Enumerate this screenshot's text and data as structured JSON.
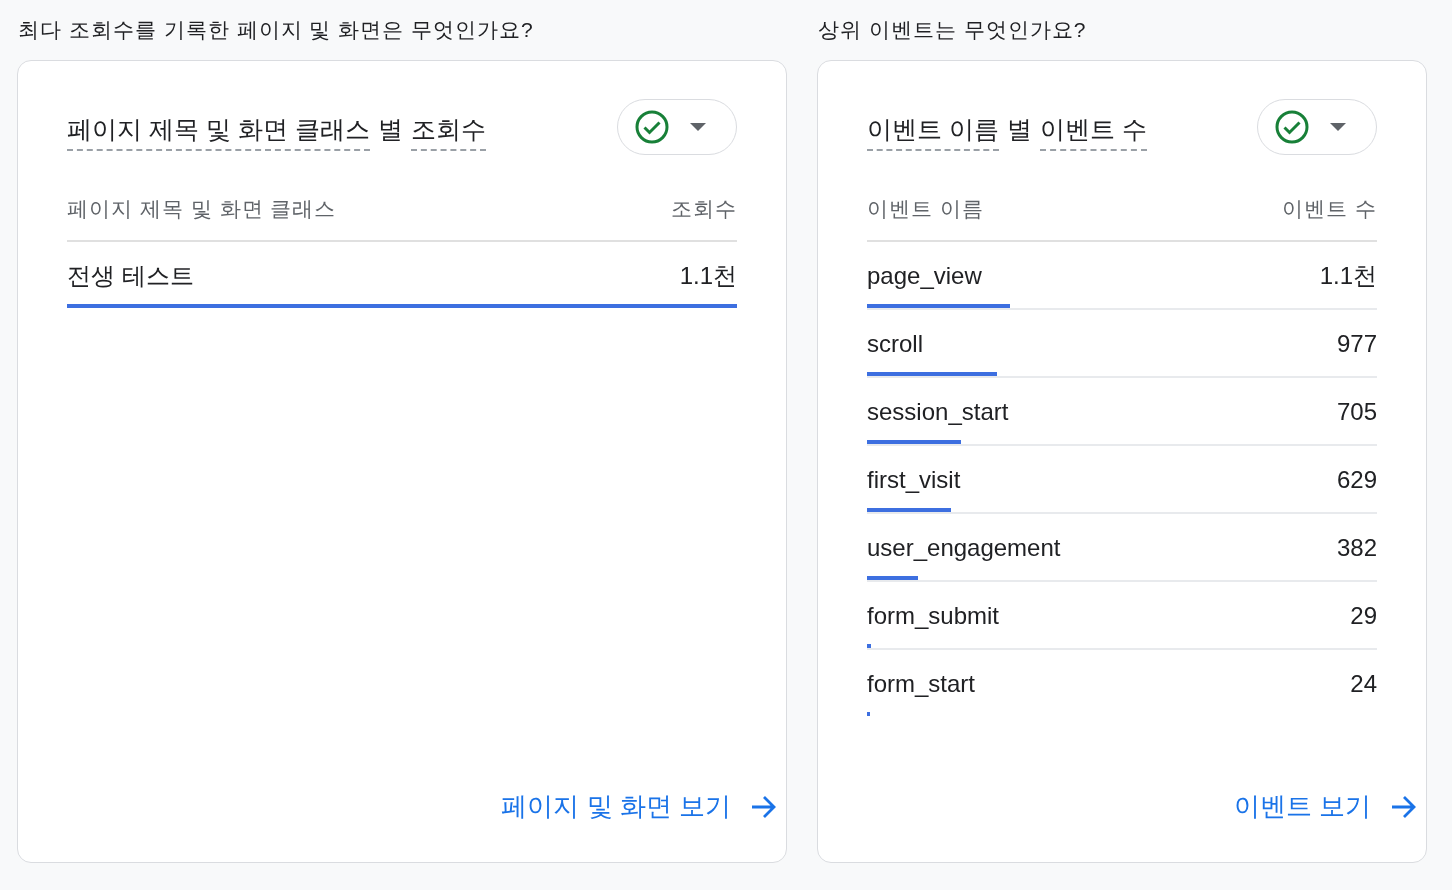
{
  "sections": [
    {
      "heading": "최다 조회수를 기록한 페이지 및 화면은 무엇인가요?",
      "card": {
        "title": {
          "dimension": "페이지 제목 및 화면 클래스",
          "connector": "별",
          "metric": "조회수"
        },
        "columns": [
          "페이지 제목 및 화면 클래스",
          "조회수"
        ],
        "rows": [
          {
            "name": "전생 테스트",
            "value": "1.1천",
            "level": 1
          }
        ],
        "link": "페이지 및 화면 보기"
      }
    },
    {
      "heading": "상위 이벤트는 무엇인가요?",
      "card": {
        "title": {
          "dimension": "이벤트 이름",
          "connector": "별",
          "metric": "이벤트 수"
        },
        "columns": [
          "이벤트 이름",
          "이벤트 수"
        ],
        "rows": [
          {
            "name": "page_view",
            "value": "1.1천",
            "level": 0.28
          },
          {
            "name": "scroll",
            "value": "977",
            "level": 0.254
          },
          {
            "name": "session_start",
            "value": "705",
            "level": 0.184
          },
          {
            "name": "first_visit",
            "value": "629",
            "level": 0.164
          },
          {
            "name": "user_engagement",
            "value": "382",
            "level": 0.1
          },
          {
            "name": "form_submit",
            "value": "29",
            "level": 0.008
          },
          {
            "name": "form_start",
            "value": "24",
            "level": 0.006
          }
        ],
        "link": "이벤트 보기"
      }
    }
  ]
}
